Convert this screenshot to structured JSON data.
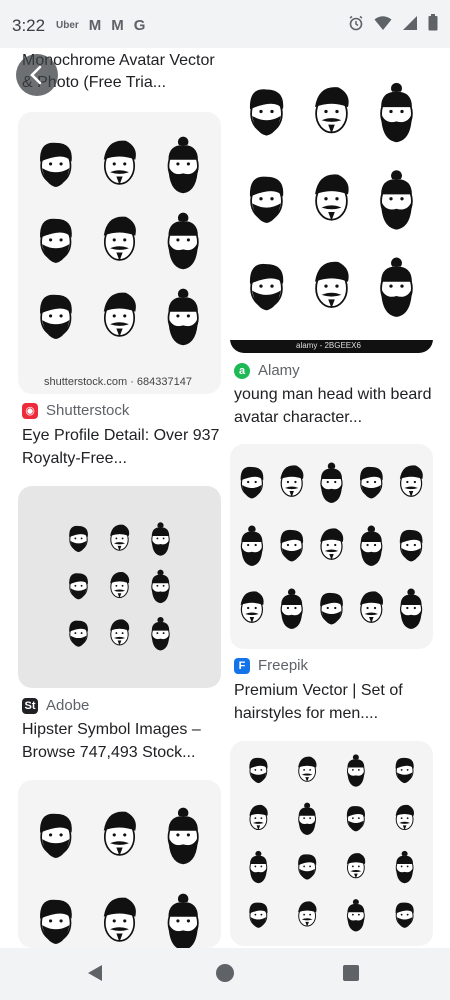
{
  "status_bar": {
    "time": "3:22",
    "apps": [
      "Uber",
      "M",
      "M",
      "G"
    ]
  },
  "top_caption": "Monochrome Avatar Vector & Photo (Free Tria...",
  "results": [
    {
      "source": "Shutterstock",
      "title": "Eye Profile Detail: Over 937 Royalty-Free...",
      "watermark": "shutterstock.com · 684337147",
      "logo_color": "#ee2b3b"
    },
    {
      "source": "Alamy",
      "title": "young man head with beard avatar character...",
      "watermark": "alamy - 2BGEEX6",
      "logo_color": "#1db954"
    },
    {
      "source": "Freepik",
      "title": "Premium Vector | Set of hairstyles for men....",
      "logo_color": "#1273eb"
    },
    {
      "source": "Adobe",
      "title": "Hipster Symbol Images – Browse 747,493 Stock...",
      "logo_color": "#202124"
    }
  ]
}
